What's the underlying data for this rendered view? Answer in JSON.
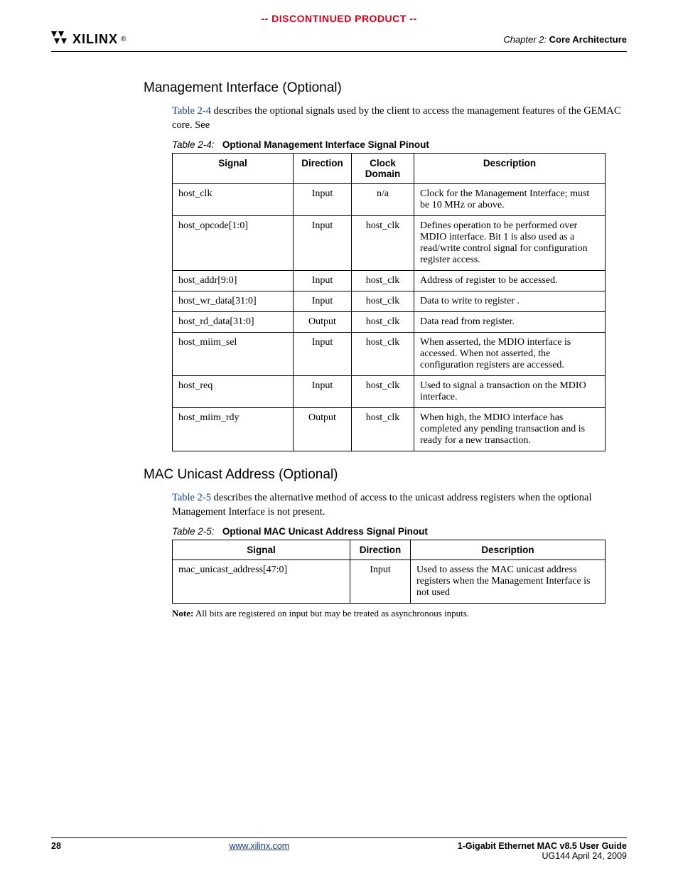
{
  "banner": "-- DISCONTINUED PRODUCT --",
  "logo": {
    "brand": "XILINX",
    "reg": "®"
  },
  "chapter": {
    "prefix": "Chapter 2:",
    "title": "Core Architecture"
  },
  "sec1": {
    "heading": "Management Interface (Optional)",
    "para_link": "Table 2-4",
    "para_rest": " describes the optional signals used by the client to access the management features of the GEMAC core. See",
    "caption_num": "Table 2-4:",
    "caption_title": "Optional Management Interface Signal Pinout",
    "head": {
      "c1": "Signal",
      "c2": "Direction",
      "c3": "Clock Domain",
      "c4": "Description"
    },
    "rows": [
      {
        "sig": "host_clk",
        "dir": "Input",
        "clk": "n/a",
        "desc": "Clock for the Management Interface; must be 10 MHz or above."
      },
      {
        "sig": "host_opcode[1:0]",
        "dir": "Input",
        "clk": "host_clk",
        "desc": "Defines operation to be performed over MDIO interface. Bit 1 is also used as a read/write control signal for configuration register access."
      },
      {
        "sig": "host_addr[9:0]",
        "dir": "Input",
        "clk": "host_clk",
        "desc": "Address of register to be accessed."
      },
      {
        "sig": "host_wr_data[31:0]",
        "dir": "Input",
        "clk": "host_clk",
        "desc": "Data to write to register ."
      },
      {
        "sig": "host_rd_data[31:0]",
        "dir": "Output",
        "clk": "host_clk",
        "desc": "Data read from register."
      },
      {
        "sig": "host_miim_sel",
        "dir": "Input",
        "clk": "host_clk",
        "desc": "When asserted, the MDIO interface is accessed. When not asserted, the configuration registers are accessed."
      },
      {
        "sig": "host_req",
        "dir": "Input",
        "clk": "host_clk",
        "desc": "Used to signal a transaction on the MDIO interface."
      },
      {
        "sig": "host_miim_rdy",
        "dir": "Output",
        "clk": "host_clk",
        "desc": "When high, the MDIO interface has completed any pending transaction and is ready for a new transaction."
      }
    ]
  },
  "sec2": {
    "heading": "MAC Unicast Address (Optional)",
    "para_link": "Table 2-5",
    "para_rest": " describes the alternative method of access to the unicast address registers when the optional Management Interface is not present.",
    "caption_num": "Table 2-5:",
    "caption_title": "Optional MAC Unicast Address Signal Pinout",
    "head": {
      "c1": "Signal",
      "c2": "Direction",
      "c3": "Description"
    },
    "rows": [
      {
        "sig": "mac_unicast_address[47:0]",
        "dir": "Input",
        "desc": "Used to assess the MAC unicast address registers when the Management Interface is not used"
      }
    ],
    "note_label": "Note:",
    "note_text": " All bits are registered on input but may be treated as asynchronous inputs."
  },
  "footer": {
    "page": "28",
    "url": "www.xilinx.com",
    "guide": "1-Gigabit Ethernet MAC v8.5 User Guide",
    "docid": "UG144 April 24, 2009"
  }
}
